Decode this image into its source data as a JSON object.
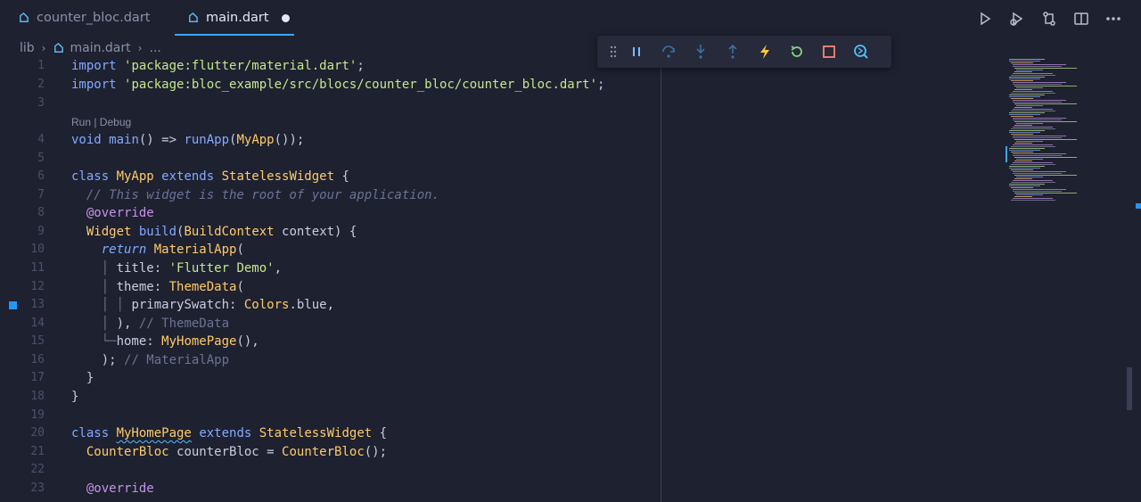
{
  "tabs": [
    {
      "label": "counter_bloc.dart",
      "active": false,
      "dirty": false
    },
    {
      "label": "main.dart",
      "active": true,
      "dirty": true
    }
  ],
  "breadcrumb": {
    "folder": "lib",
    "file": "main.dart",
    "more": "..."
  },
  "window_actions": [
    "run-icon",
    "debug-run-icon",
    "source-control-icon",
    "split-editor-icon",
    "more-icon"
  ],
  "debug_toolbar": [
    "drag-grip-icon",
    "pause-icon",
    "step-over-icon",
    "step-into-icon",
    "step-out-icon",
    "hot-reload-icon",
    "restart-icon",
    "stop-icon",
    "devtools-icon"
  ],
  "codelens": {
    "text": "Run | Debug"
  },
  "lines": [
    {
      "n": "1",
      "tokens": [
        [
          "kw",
          "import "
        ],
        [
          "str",
          "'package:flutter/material.dart'"
        ],
        [
          "plain",
          ";"
        ]
      ]
    },
    {
      "n": "2",
      "tokens": [
        [
          "kw",
          "import "
        ],
        [
          "str",
          "'package:bloc_example/src/blocs/counter_bloc/counter_bloc.dart'"
        ],
        [
          "plain",
          ";"
        ]
      ]
    },
    {
      "n": "3",
      "tokens": []
    },
    {
      "n": "4",
      "tokens": [
        [
          "kw",
          "void "
        ],
        [
          "fn",
          "main"
        ],
        [
          "plain",
          "() => "
        ],
        [
          "fn",
          "runApp"
        ],
        [
          "plain",
          "("
        ],
        [
          "type",
          "MyApp"
        ],
        [
          "plain",
          "());"
        ]
      ]
    },
    {
      "n": "5",
      "tokens": []
    },
    {
      "n": "6",
      "tokens": [
        [
          "kw",
          "class "
        ],
        [
          "type",
          "MyApp "
        ],
        [
          "kw",
          "extends "
        ],
        [
          "type",
          "StatelessWidget "
        ],
        [
          "plain",
          "{"
        ]
      ]
    },
    {
      "n": "7",
      "tokens": [
        [
          "plain",
          "  "
        ],
        [
          "cmt",
          "// This widget is the root of your application."
        ]
      ]
    },
    {
      "n": "8",
      "tokens": [
        [
          "plain",
          "  "
        ],
        [
          "ann",
          "@override"
        ]
      ]
    },
    {
      "n": "9",
      "tokens": [
        [
          "plain",
          "  "
        ],
        [
          "type",
          "Widget "
        ],
        [
          "fn",
          "build"
        ],
        [
          "plain",
          "("
        ],
        [
          "type",
          "BuildContext"
        ],
        [
          "plain",
          " context) {"
        ]
      ]
    },
    {
      "n": "10",
      "tokens": [
        [
          "plain",
          "    "
        ],
        [
          "kw2",
          "return "
        ],
        [
          "type",
          "MaterialApp"
        ],
        [
          "plain",
          "("
        ]
      ]
    },
    {
      "n": "11",
      "tokens": [
        [
          "plain",
          "    "
        ],
        [
          "guide",
          "│ "
        ],
        [
          "plain",
          "title: "
        ],
        [
          "str",
          "'Flutter Demo'"
        ],
        [
          "plain",
          ","
        ]
      ]
    },
    {
      "n": "12",
      "tokens": [
        [
          "plain",
          "    "
        ],
        [
          "guide",
          "│ "
        ],
        [
          "plain",
          "theme: "
        ],
        [
          "type",
          "ThemeData"
        ],
        [
          "plain",
          "("
        ]
      ]
    },
    {
      "n": "13",
      "tokens": [
        [
          "plain",
          "    "
        ],
        [
          "guide",
          "│ "
        ],
        [
          "guide",
          "│ "
        ],
        [
          "plain",
          "primarySwatch: "
        ],
        [
          "type",
          "Colors"
        ],
        [
          "plain",
          ".blue,"
        ]
      ]
    },
    {
      "n": "14",
      "tokens": [
        [
          "plain",
          "    "
        ],
        [
          "guide",
          "│ "
        ],
        [
          "plain",
          "), "
        ],
        [
          "cmt2",
          "// ThemeData"
        ]
      ]
    },
    {
      "n": "15",
      "tokens": [
        [
          "plain",
          "    "
        ],
        [
          "guide",
          "└─"
        ],
        [
          "plain",
          "home: "
        ],
        [
          "type",
          "MyHomePage"
        ],
        [
          "plain",
          "(),"
        ]
      ]
    },
    {
      "n": "16",
      "tokens": [
        [
          "plain",
          "    ); "
        ],
        [
          "cmt2",
          "// MaterialApp"
        ]
      ]
    },
    {
      "n": "17",
      "tokens": [
        [
          "plain",
          "  }"
        ]
      ]
    },
    {
      "n": "18",
      "tokens": [
        [
          "plain",
          "}"
        ]
      ]
    },
    {
      "n": "19",
      "tokens": []
    },
    {
      "n": "20",
      "tokens": [
        [
          "kw",
          "class "
        ],
        [
          "type squiggle",
          "MyHomePage"
        ],
        [
          "plain",
          " "
        ],
        [
          "kw",
          "extends "
        ],
        [
          "type",
          "StatelessWidget "
        ],
        [
          "plain",
          "{"
        ]
      ]
    },
    {
      "n": "21",
      "tokens": [
        [
          "plain",
          "  "
        ],
        [
          "type",
          "CounterBloc "
        ],
        [
          "plain",
          "counterBloc = "
        ],
        [
          "type",
          "CounterBloc"
        ],
        [
          "plain",
          "();"
        ]
      ]
    },
    {
      "n": "22",
      "tokens": []
    },
    {
      "n": "23",
      "tokens": [
        [
          "plain",
          "  "
        ],
        [
          "ann",
          "@override"
        ]
      ]
    }
  ]
}
